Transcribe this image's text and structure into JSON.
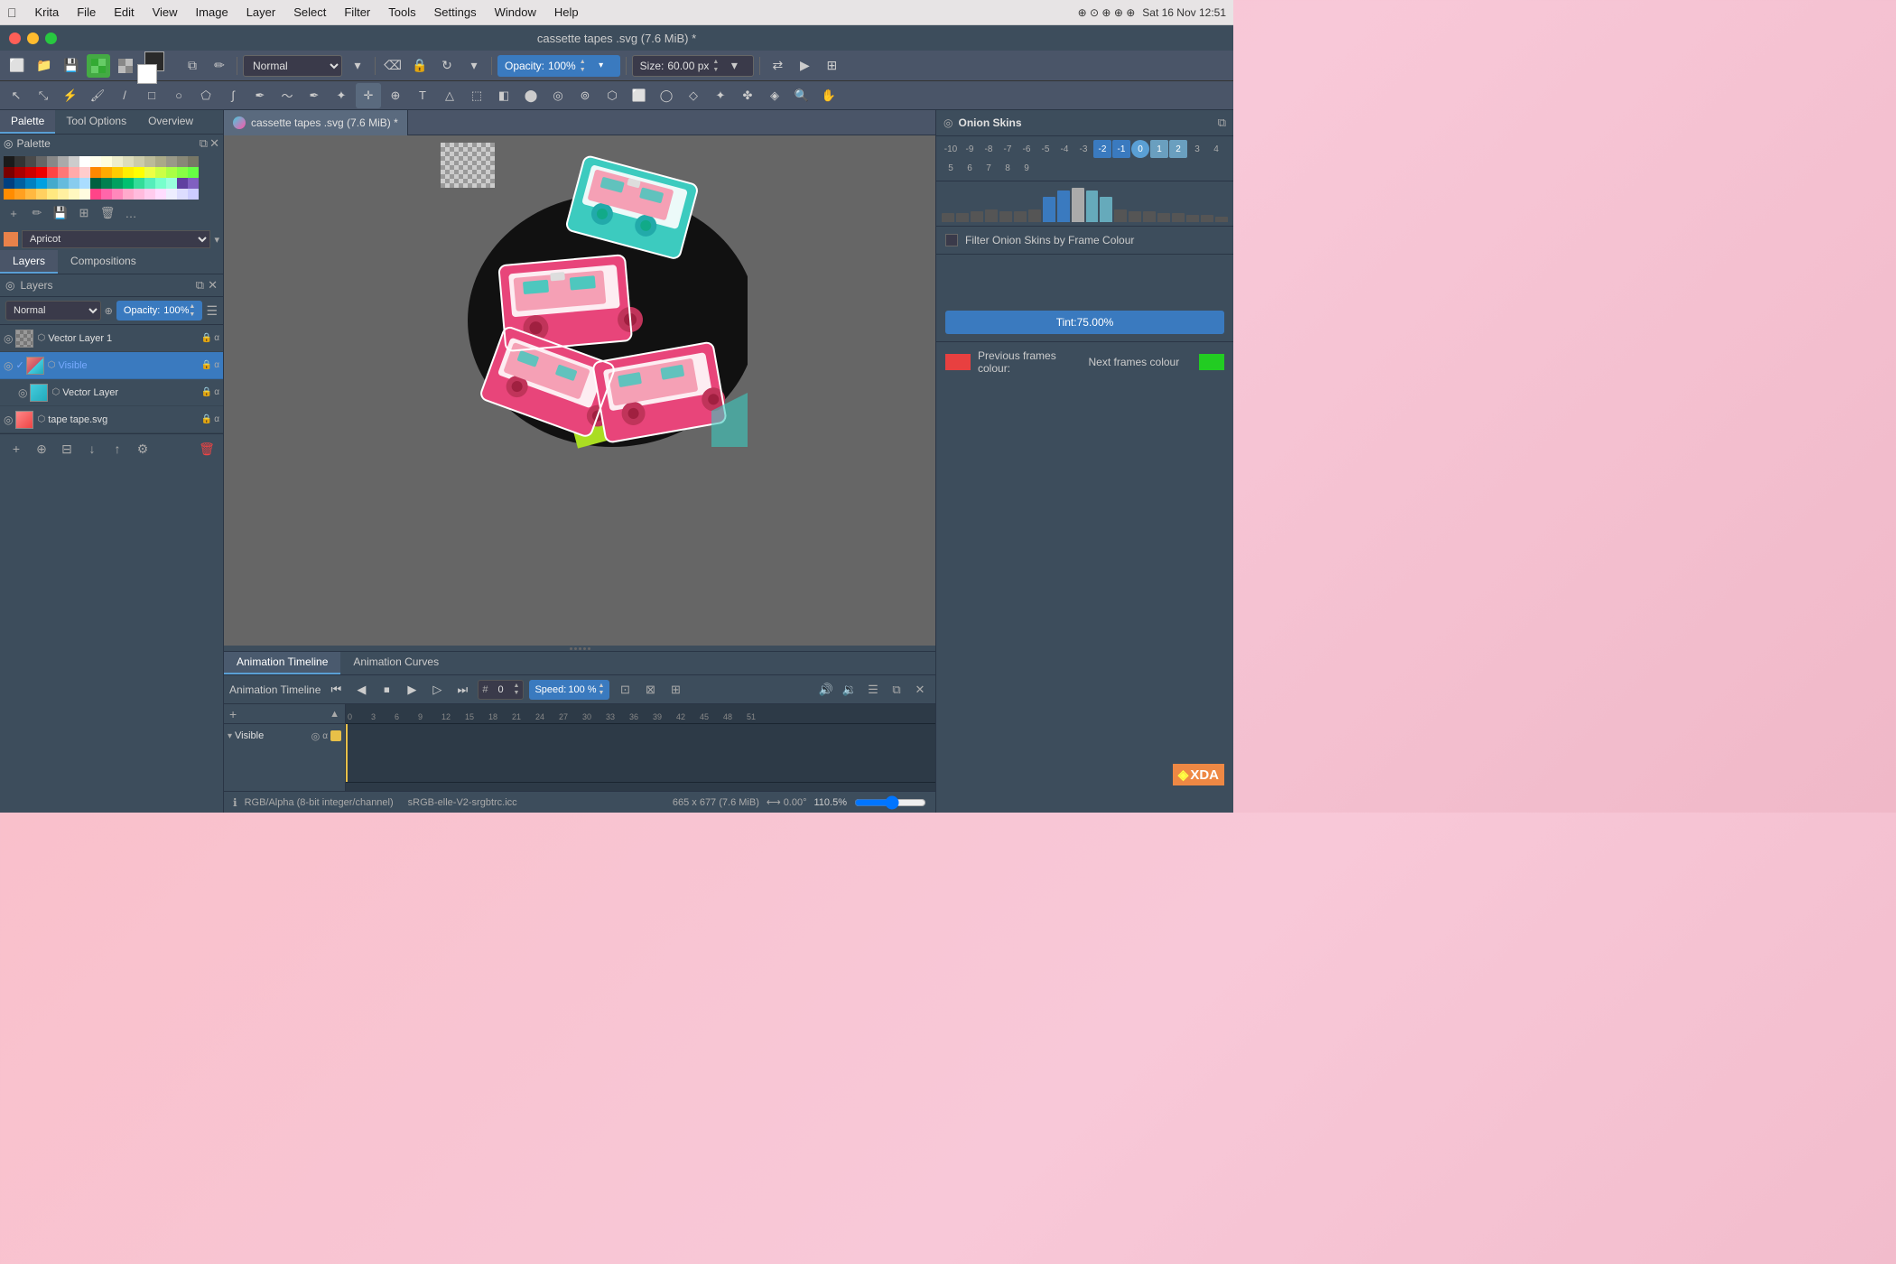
{
  "os": {
    "menubar": {
      "apple": "⌘",
      "app": "Krita",
      "items": [
        "File",
        "Edit",
        "View",
        "Image",
        "Layer",
        "Select",
        "Filter",
        "Tools",
        "Settings",
        "Window",
        "Help"
      ],
      "time": "Sat 16 Nov  12:51"
    }
  },
  "window": {
    "title": "cassette tapes .svg (7.6 MiB) *",
    "canvas_title": "cassette tapes .svg (7.6 MiB) *"
  },
  "toolbar": {
    "blend_mode": "Normal",
    "opacity_label": "Opacity:",
    "opacity_value": "100%",
    "size_label": "Size:",
    "size_value": "60.00 px"
  },
  "palette_panel": {
    "title": "Palette",
    "name": "Apricot",
    "tabs": [
      "Palette",
      "Tool Options",
      "Overview"
    ],
    "active_tab": "Palette"
  },
  "layers_panel": {
    "title": "Layers",
    "tabs": [
      "Layers",
      "Compositions"
    ],
    "active_tab": "Layers",
    "blend_mode": "Normal",
    "opacity_label": "Opacity:",
    "opacity_value": "100%",
    "items": [
      {
        "name": "Vector Layer 1",
        "type": "vector",
        "visible": true,
        "active": false,
        "alpha": "α"
      },
      {
        "name": "Visible",
        "type": "group",
        "visible": true,
        "active": true,
        "alpha": "α"
      },
      {
        "name": "Vector Layer",
        "type": "vector",
        "visible": true,
        "active": false,
        "alpha": "α"
      },
      {
        "name": "tape tape.svg",
        "type": "svg",
        "visible": true,
        "active": false,
        "alpha": "α"
      }
    ]
  },
  "animation": {
    "timeline_tab": "Animation Timeline",
    "curves_tab": "Animation Curves",
    "active_tab": "Animation Timeline",
    "title": "Animation Timeline",
    "frame": "0",
    "speed_label": "Speed:",
    "speed_value": "100 %",
    "layer_name": "Visible",
    "ruler_marks": [
      "0",
      "3",
      "6",
      "9",
      "12",
      "15",
      "18",
      "21",
      "24",
      "27",
      "30",
      "33",
      "36",
      "39",
      "42",
      "45",
      "48",
      "51"
    ]
  },
  "onion_skins": {
    "title": "Onion Skins",
    "numbers": [
      "-10",
      "-9",
      "-8",
      "-7",
      "-6",
      "-5",
      "-4",
      "-3",
      "-2",
      "-1",
      "0",
      "1",
      "2",
      "3",
      "4",
      "5",
      "6",
      "7",
      "8",
      "9"
    ],
    "filter_label": "Filter Onion Skins by Frame Colour",
    "tint_label": "Tint:",
    "tint_value": "75.00%",
    "prev_label": "Previous frames colour:",
    "next_label": "Next frames colour"
  },
  "status_bar": {
    "color_mode": "RGB/Alpha (8-bit integer/channel)",
    "color_profile": "sRGB-elle-V2-srgbtrc.icc",
    "dimensions": "665 x 677 (7.6 MiB)",
    "rotation": "0.00°",
    "zoom": "110.5%"
  }
}
